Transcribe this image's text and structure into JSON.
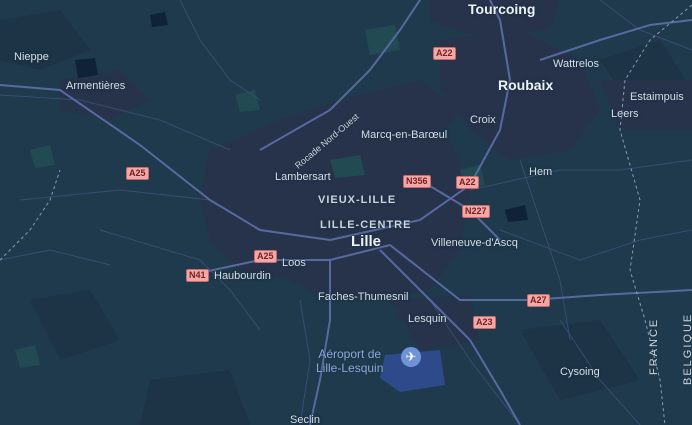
{
  "map": {
    "type": "road-map",
    "theme": "dark",
    "colors": {
      "background": "#1f3a4c",
      "urban": "#26304a",
      "water": "#0f1f33",
      "park": "#1f4a52",
      "road": "#4a5a86",
      "motorway": "#6a7cb6",
      "label": "#d6dde4",
      "shield_bg": "#f0a8a8",
      "shield_text": "#7a1f1f",
      "airport": "#6f93d6"
    },
    "places": {
      "tourcoing": "Tourcoing",
      "roubaix": "Roubaix",
      "wattrelos": "Wattrelos",
      "estaimpuis": "Estaimpuis",
      "leers": "Leers",
      "nieppe": "Nieppe",
      "armentieres": "Armentières",
      "croix": "Croix",
      "marcq": "Marcq-en-Barœul",
      "hem": "Hem",
      "lambersart": "Lambersart",
      "vieux_lille": "VIEUX-LILLE",
      "lille_centre": "LILLE-CENTRE",
      "lille": "Lille",
      "villeneuve": "Villeneuve-d'Ascq",
      "loos": "Loos",
      "haubourdin": "Haubourdin",
      "faches": "Faches-Thumesnil",
      "lesquin": "Lesquin",
      "cysoing": "Cysoing",
      "seclin": "Seclin"
    },
    "roads": {
      "a22_north": "A22",
      "a25_west": "A25",
      "n356": "N356",
      "a22_east": "A22",
      "n227": "N227",
      "a25_center": "A25",
      "n41": "N41",
      "a27": "A27",
      "a23": "A23",
      "rocade": "Rocade Nord-Ouest"
    },
    "airport": {
      "line1": "Aéroport de",
      "line2": "Lille-Lesquin",
      "icon": "airplane-icon"
    },
    "borders": {
      "france": "FRANCE",
      "belgique": "BELGIQUE"
    }
  }
}
